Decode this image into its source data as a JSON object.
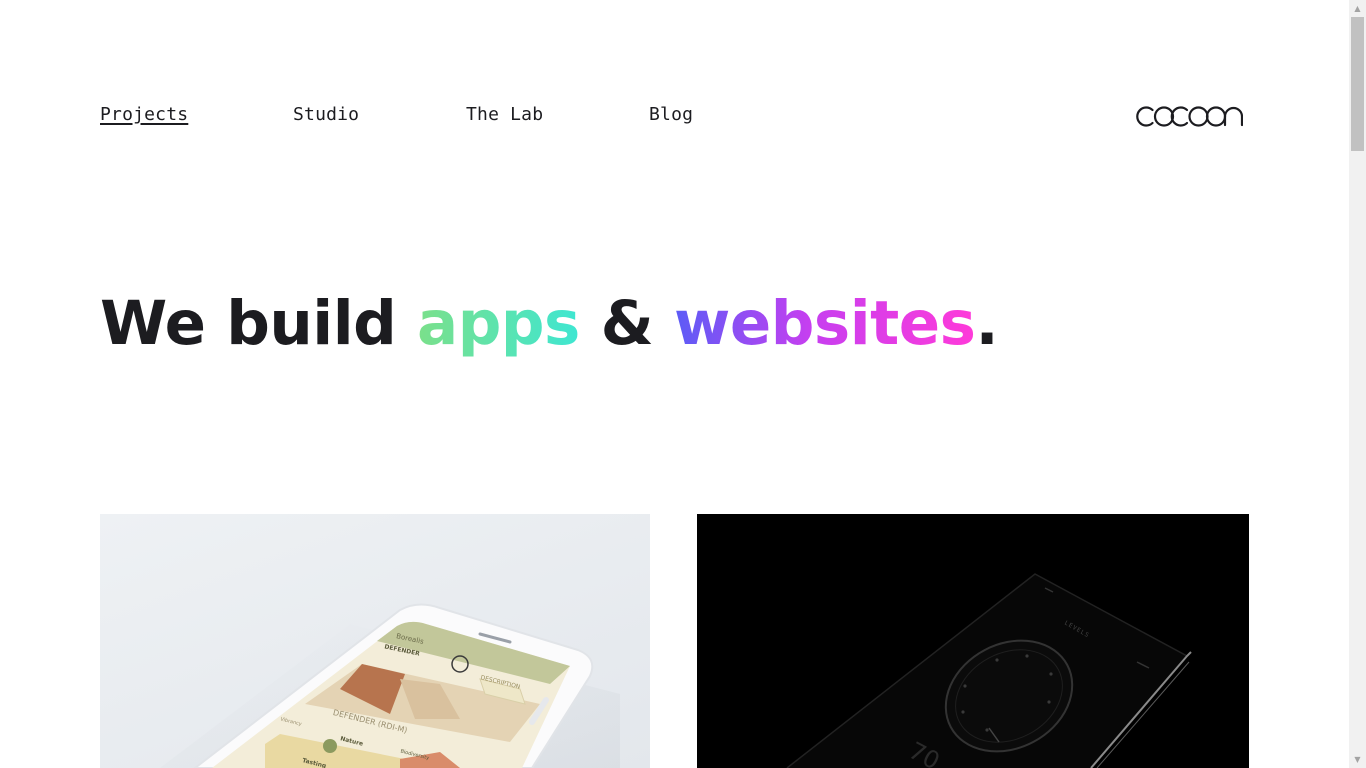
{
  "nav": {
    "items": [
      {
        "label": "Projects",
        "active": true
      },
      {
        "label": "Studio",
        "active": false
      },
      {
        "label": "The Lab",
        "active": false
      },
      {
        "label": "Blog",
        "active": false
      }
    ]
  },
  "logo": {
    "text": "cocoon"
  },
  "hero": {
    "part1": "We build ",
    "part2": "apps",
    "part3": " & ",
    "part4": "websites",
    "part5": "."
  },
  "projects": [
    {
      "theme": "light",
      "screen": {
        "header": "Borealis",
        "tab_left": "DEFENDER",
        "tab_right": "DESCRIPTION",
        "subtitle": "DEFENDER (RDI-M)",
        "label1": "Nature",
        "label2": "Vibrancy",
        "label3": "Tasting",
        "label4": "Biodiversity"
      }
    },
    {
      "theme": "dark",
      "screen": {
        "header": "LEVELS",
        "readout": "70"
      }
    }
  ],
  "colors": {
    "text": "#1c1c20",
    "apps_gradient": [
      "#7be08a",
      "#3ee6d2"
    ],
    "websites_gradient": [
      "#5b5cf6",
      "#c63ff0",
      "#ff3ad9"
    ]
  },
  "scrollbar": {
    "up_icon": "triangle-up-icon",
    "down_icon": "triangle-down-icon"
  }
}
